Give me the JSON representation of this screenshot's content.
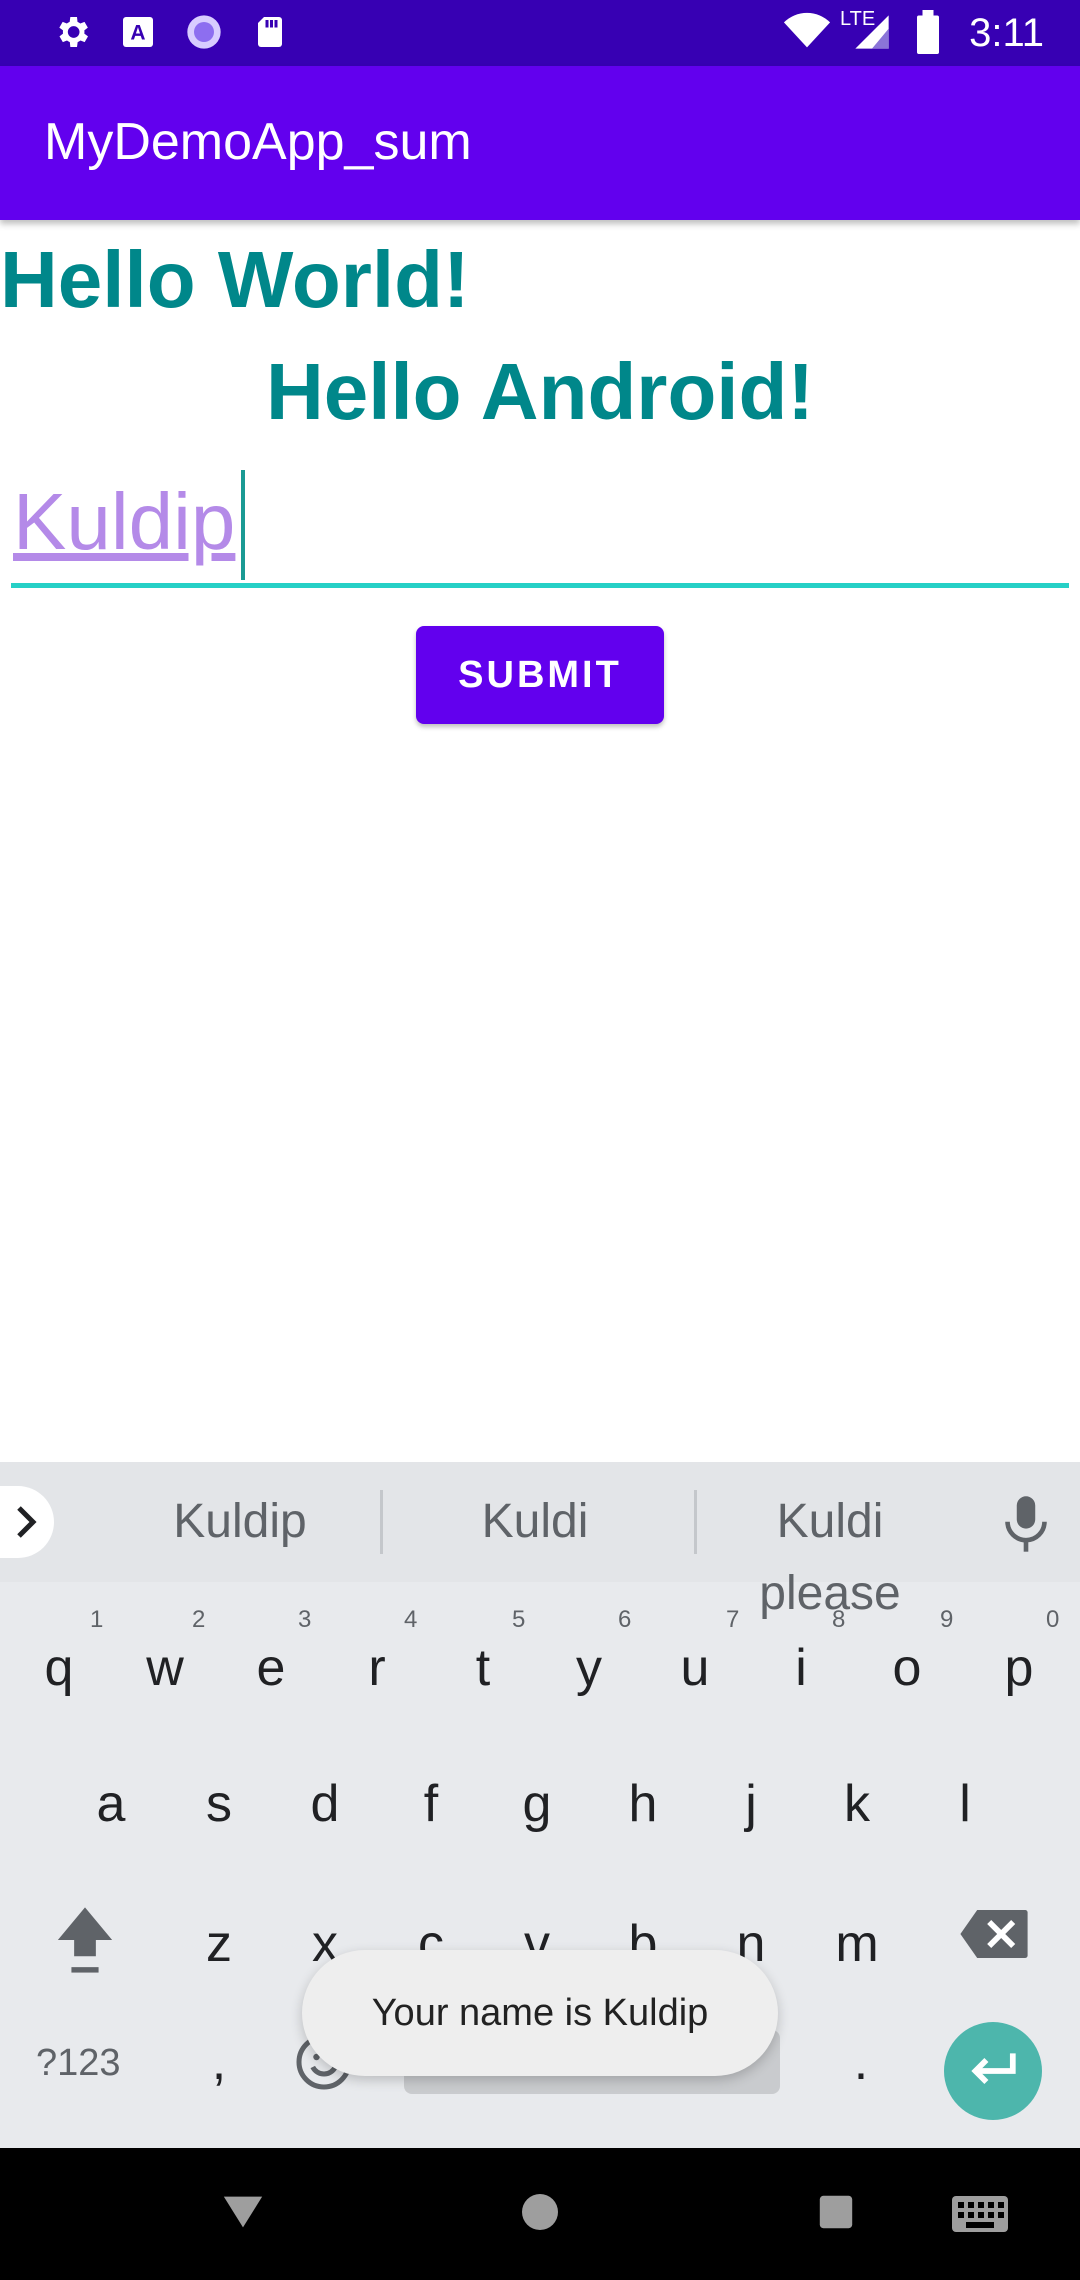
{
  "status_bar": {
    "time": "3:11",
    "network": "LTE",
    "icons": [
      "settings-icon",
      "accessibility-icon",
      "sync-icon",
      "sd-card-icon",
      "wifi-icon",
      "signal-icon",
      "battery-icon"
    ]
  },
  "app_bar": {
    "title": "MyDemoApp_sum"
  },
  "content": {
    "hello_world": "Hello World!",
    "hello_android": "Hello Android!",
    "name_input_value": "Kuldip",
    "submit_label": "SUBMIT"
  },
  "keyboard": {
    "suggestions": [
      "Kuldip",
      "Kuldi",
      "Kuldi please"
    ],
    "row1": [
      "q",
      "w",
      "e",
      "r",
      "t",
      "y",
      "u",
      "i",
      "o",
      "p"
    ],
    "row1_hints": [
      "1",
      "2",
      "3",
      "4",
      "5",
      "6",
      "7",
      "8",
      "9",
      "0"
    ],
    "row2": [
      "a",
      "s",
      "d",
      "f",
      "g",
      "h",
      "j",
      "k",
      "l"
    ],
    "row3": [
      "z",
      "x",
      "c",
      "v",
      "b",
      "n",
      "m"
    ],
    "symbols_label": "?123",
    "comma": ",",
    "period": "."
  },
  "toast": {
    "message": "Your name is Kuldip"
  },
  "colors": {
    "primary": "#6200ee",
    "primary_dark": "#3700b3",
    "teal_text": "#00878a",
    "accent": "#26d0c6"
  }
}
